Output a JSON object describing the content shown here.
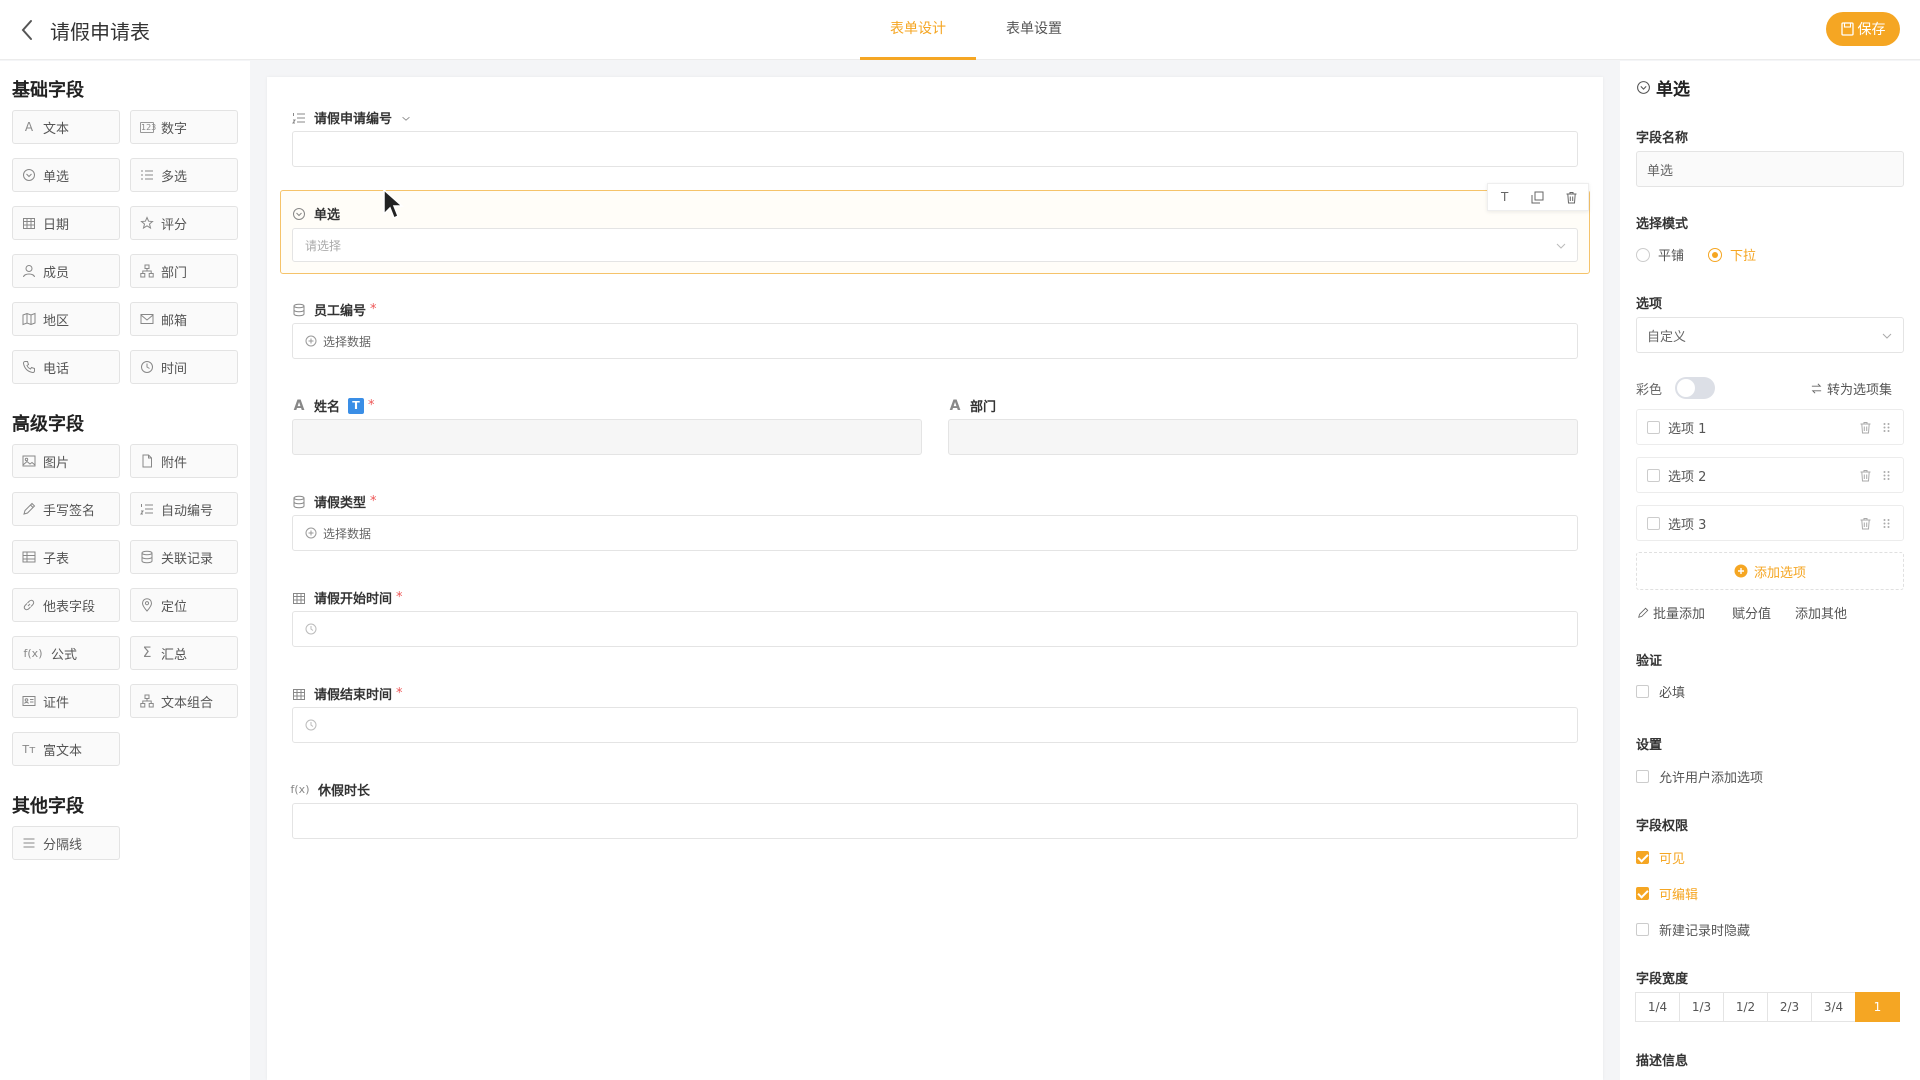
{
  "header": {
    "title": "请假申请表",
    "tabs": [
      {
        "label": "表单设计"
      },
      {
        "label": "表单设置"
      }
    ],
    "save_label": "保存"
  },
  "palette": {
    "basic": {
      "title": "基础字段",
      "items": [
        {
          "label": "文本",
          "icon": "A"
        },
        {
          "label": "数字",
          "icon": "123"
        },
        {
          "label": "单选",
          "icon": "radio-icon"
        },
        {
          "label": "多选",
          "icon": "list-icon"
        },
        {
          "label": "日期",
          "icon": "calendar-icon"
        },
        {
          "label": "评分",
          "icon": "star-icon"
        },
        {
          "label": "成员",
          "icon": "user-icon"
        },
        {
          "label": "部门",
          "icon": "org-icon"
        },
        {
          "label": "地区",
          "icon": "map-icon"
        },
        {
          "label": "邮箱",
          "icon": "mail-icon"
        },
        {
          "label": "电话",
          "icon": "phone-icon"
        },
        {
          "label": "时间",
          "icon": "clock-icon"
        }
      ]
    },
    "advanced": {
      "title": "高级字段",
      "items": [
        {
          "label": "图片",
          "icon": "image-icon"
        },
        {
          "label": "附件",
          "icon": "file-icon"
        },
        {
          "label": "手写签名",
          "icon": "pen-icon"
        },
        {
          "label": "自动编号",
          "icon": "numbered-list-icon"
        },
        {
          "label": "子表",
          "icon": "table-icon"
        },
        {
          "label": "关联记录",
          "icon": "database-icon"
        },
        {
          "label": "他表字段",
          "icon": "link-icon"
        },
        {
          "label": "定位",
          "icon": "location-icon"
        },
        {
          "label": "公式",
          "icon": "f(x)"
        },
        {
          "label": "汇总",
          "icon": "Σ"
        },
        {
          "label": "证件",
          "icon": "id-card-icon"
        },
        {
          "label": "文本组合",
          "icon": "org-icon"
        },
        {
          "label": "富文本",
          "icon": "Tт"
        }
      ]
    },
    "other": {
      "title": "其他字段",
      "items": [
        {
          "label": "分隔线",
          "icon": "divider-icon"
        }
      ]
    }
  },
  "canvas": {
    "fields": {
      "leave_no": {
        "label": "请假申请编号"
      },
      "single": {
        "label": "单选",
        "placeholder": "请选择"
      },
      "emp_no": {
        "label": "员工编号",
        "required": "*",
        "placeholder": "选择数据"
      },
      "name": {
        "label": "姓名",
        "badge": "T",
        "required": "*"
      },
      "dept": {
        "label": "部门"
      },
      "leave_type": {
        "label": "请假类型",
        "required": "*",
        "placeholder": "选择数据"
      },
      "start": {
        "label": "请假开始时间",
        "required": "*"
      },
      "end": {
        "label": "请假结束时间",
        "required": "*"
      },
      "duration": {
        "label": "休假时长",
        "icon": "f(x)"
      }
    }
  },
  "props": {
    "title": "单选",
    "field_name_label": "字段名称",
    "field_name_value": "单选",
    "mode_label": "选择模式",
    "modes": [
      {
        "label": "平铺"
      },
      {
        "label": "下拉"
      }
    ],
    "options_label": "选项",
    "options_source": "自定义",
    "color_label": "彩色",
    "convert_label": "转为选项集",
    "options": [
      {
        "label": "选项 1"
      },
      {
        "label": "选项 2"
      },
      {
        "label": "选项 3"
      }
    ],
    "add_option": "添加选项",
    "batch_add": "批量添加",
    "assign_value": "赋分值",
    "add_other": "添加其他",
    "validation_label": "验证",
    "required_label": "必填",
    "settings_label": "设置",
    "allow_user_add": "允许用户添加选项",
    "permission_label": "字段权限",
    "perm_visible": "可见",
    "perm_editable": "可编辑",
    "perm_hide_new": "新建记录时隐藏",
    "width_label": "字段宽度",
    "widths": [
      "1/4",
      "1/3",
      "1/2",
      "2/3",
      "3/4",
      "1"
    ],
    "desc_label": "描述信息"
  },
  "colors": {
    "accent": "#f5a623",
    "badge": "#3a8ee6",
    "required": "#e55"
  }
}
